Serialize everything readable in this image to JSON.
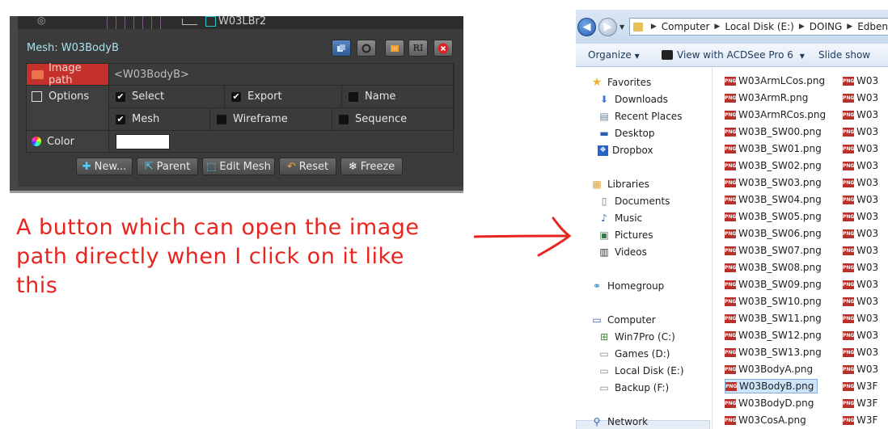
{
  "panel": {
    "outliner_item": "W03LBr2",
    "mesh_title": "Mesh: W03BodyB",
    "image_path_label": "Image path",
    "image_path_value": "<W03BodyB>",
    "options_label": "Options",
    "color_label": "Color",
    "options": [
      "Select",
      "Export",
      "Name",
      "Mesh",
      "Wireframe",
      "Sequence"
    ],
    "options_checked": [
      true,
      true,
      false,
      true,
      false,
      false
    ],
    "tool_icons": [
      "stack-icon",
      "circle-icon",
      "puzzle-icon",
      "ri-icon",
      "close-icon"
    ],
    "tool_ri": "RI",
    "buttons": {
      "new": "New...",
      "parent": "Parent",
      "edit_mesh": "Edit Mesh",
      "reset": "Reset",
      "freeze": "Freeze"
    },
    "colors": {
      "accent": "#2fc1c8",
      "image_path_bg": "#c3312a",
      "panel_bg": "#3b3b3b"
    }
  },
  "annotation": {
    "text_line1": "A button which can open the image",
    "text_line2": "path directly when I click on it like",
    "text_line3": "this",
    "color": "#e8241e"
  },
  "explorer": {
    "breadcrumb": [
      "Computer",
      "Local Disk (E:)",
      "DOING",
      "Edben"
    ],
    "commands": {
      "organize": "Organize",
      "view_with": "View with ACDSee Pro 6",
      "slideshow": "Slide show"
    },
    "nav": {
      "favorites": "Favorites",
      "downloads": "Downloads",
      "recent": "Recent Places",
      "desktop": "Desktop",
      "dropbox": "Dropbox",
      "libraries": "Libraries",
      "documents": "Documents",
      "music": "Music",
      "pictures": "Pictures",
      "videos": "Videos",
      "homegroup": "Homegroup",
      "computer": "Computer",
      "c": "Win7Pro (C:)",
      "d": "Games (D:)",
      "e": "Local Disk (E:)",
      "f": "Backup (F:)",
      "network": "Network"
    },
    "files_col1": [
      "W03ArmLCos.png",
      "W03ArmR.png",
      "W03ArmRCos.png",
      "W03B_SW00.png",
      "W03B_SW01.png",
      "W03B_SW02.png",
      "W03B_SW03.png",
      "W03B_SW04.png",
      "W03B_SW05.png",
      "W03B_SW06.png",
      "W03B_SW07.png",
      "W03B_SW08.png",
      "W03B_SW09.png",
      "W03B_SW10.png",
      "W03B_SW11.png",
      "W03B_SW12.png",
      "W03B_SW13.png",
      "W03BodyA.png",
      "W03BodyB.png",
      "W03BodyD.png",
      "W03CosA.png"
    ],
    "files_col2": [
      "W03",
      "W03",
      "W03",
      "W03",
      "W03",
      "W03",
      "W03",
      "W03",
      "W03",
      "W03",
      "W03",
      "W03",
      "W03",
      "W03",
      "W03",
      "W03",
      "W03",
      "W03",
      "W3F",
      "W3F",
      "W3F"
    ],
    "selected_file": "W03BodyB.png",
    "png_badge": "PNG"
  }
}
